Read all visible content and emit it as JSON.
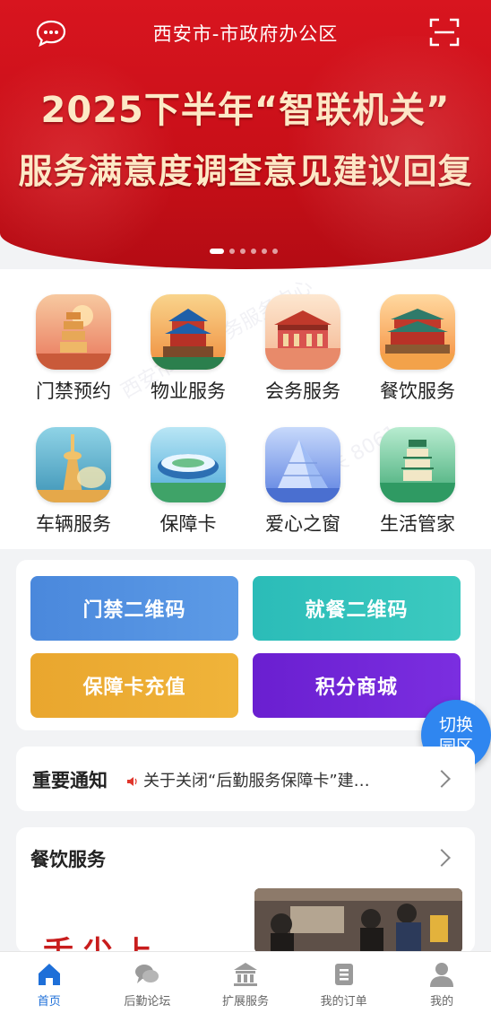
{
  "header": {
    "location": "西安市-市政府办公区",
    "headline_line1": "2025下半年“智联机关”",
    "headline_line2": "服务满意度调查意见建议回复",
    "carousel_count": 6,
    "carousel_active": 0
  },
  "services": [
    {
      "label": "门禁预约",
      "icon": "pagoda-icon"
    },
    {
      "label": "物业服务",
      "icon": "bell-tower-icon"
    },
    {
      "label": "会务服务",
      "icon": "palace-icon"
    },
    {
      "label": "餐饮服务",
      "icon": "gate-tower-icon"
    },
    {
      "label": "车辆服务",
      "icon": "tv-tower-icon"
    },
    {
      "label": "保障卡",
      "icon": "stadium-icon"
    },
    {
      "label": "爱心之窗",
      "icon": "glass-building-icon"
    },
    {
      "label": "生活管家",
      "icon": "green-tower-icon"
    }
  ],
  "quick_actions": {
    "access_qr": "门禁二维码",
    "dining_qr": "就餐二维码",
    "card_topup": "保障卡充值",
    "points_mall": "积分商城"
  },
  "switch_button": {
    "line1": "切换",
    "line2": "园区"
  },
  "notice": {
    "title": "重要通知",
    "text": "关于关闭“后勤服务保障卡”建…"
  },
  "dining_section": {
    "title": "餐饮服务",
    "deco_text": "舌尖上"
  },
  "tabbar": [
    {
      "label": "首页",
      "icon": "home-icon",
      "active": true
    },
    {
      "label": "后勤论坛",
      "icon": "chat-bubbles-icon",
      "active": false
    },
    {
      "label": "扩展服务",
      "icon": "bank-icon",
      "active": false
    },
    {
      "label": "我的订单",
      "icon": "order-icon",
      "active": false
    },
    {
      "label": "我的",
      "icon": "user-icon",
      "active": false
    }
  ],
  "colors": {
    "banner_red": "#d8151f",
    "accent_blue": "#1e6fd8",
    "access_qr_bg": "#4a88dc",
    "dining_qr_bg": "#2bbcb8",
    "card_topup_bg": "#e9a62e",
    "points_mall_bg": "#6a1fd0",
    "switch_bg": "#2f86f0"
  }
}
